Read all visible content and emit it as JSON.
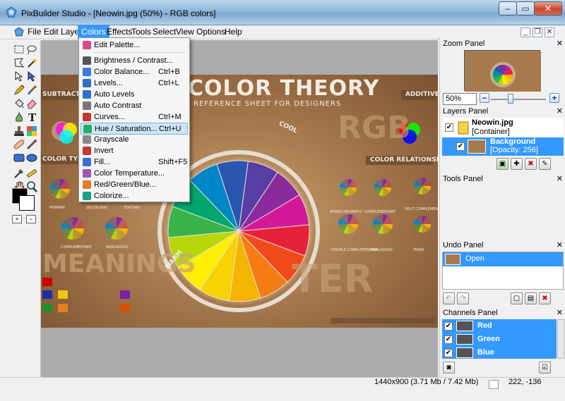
{
  "window": {
    "title": "PixBuilder Studio - [Neowin.jpg (50%) - RGB colors]",
    "min_label": "‒",
    "max_label": "▭",
    "close_label": "✕"
  },
  "menu": [
    {
      "label": "File"
    },
    {
      "label": "Edit"
    },
    {
      "label": "Layer"
    },
    {
      "label": "Colors"
    },
    {
      "label": "Effects"
    },
    {
      "label": "Tools"
    },
    {
      "label": "Select"
    },
    {
      "label": "View"
    },
    {
      "label": "Options"
    },
    {
      "label": "Help"
    }
  ],
  "colors_menu": {
    "items": [
      {
        "label": "Edit Palette...",
        "shortcut": "",
        "icon_color": "#d9488a"
      },
      {
        "label": "Brightness / Contrast...",
        "shortcut": "",
        "icon_color": "#555555"
      },
      {
        "label": "Color Balance...",
        "shortcut": "Ctrl+B",
        "icon_color": "#3a7bd5"
      },
      {
        "label": "Levels...",
        "shortcut": "Ctrl+L",
        "icon_color": "#2e6fc7"
      },
      {
        "label": "Auto Levels",
        "shortcut": "",
        "icon_color": "#2e6fc7"
      },
      {
        "label": "Auto Contrast",
        "shortcut": "",
        "icon_color": "#777777"
      },
      {
        "label": "Curves...",
        "shortcut": "Ctrl+M",
        "icon_color": "#c0392b"
      },
      {
        "label": "Hue / Saturation...",
        "shortcut": "Ctrl+U",
        "icon_color": "#27ae60"
      },
      {
        "label": "Grayscale",
        "shortcut": "",
        "icon_color": "#888888"
      },
      {
        "label": "Invert",
        "shortcut": "",
        "icon_color": "#cc3333"
      },
      {
        "label": "Fill...",
        "shortcut": "Shift+F5",
        "icon_color": "#3a6fd5"
      },
      {
        "label": "Color Temperature...",
        "shortcut": "",
        "icon_color": "#9b59b6"
      },
      {
        "label": "Red/Green/Blue...",
        "shortcut": "",
        "icon_color": "#e67e22"
      },
      {
        "label": "Colorize...",
        "shortcut": "",
        "icon_color": "#16a085"
      }
    ],
    "highlighted": "Hue / Saturation..."
  },
  "poster": {
    "title": "COLOR THEORY",
    "subtitle": "REFERENCE SHEET FOR DESIGNERS",
    "subtractive": "SUBTRACTIVE",
    "additive": "ADDITIVE",
    "rgb": "RGB",
    "color_types": "COLOR TYPES",
    "color_relationships": "COLOR RELATIONSHIPS",
    "meanings": "MEANINGS",
    "cool": "COOL",
    "warm": "WARM",
    "terms": "TER",
    "primary": "PRIMARY",
    "secondary": "SECONDARY",
    "tertiary": "TERTIARY",
    "complementary": "COMPLEMENTARY",
    "analogous": "ANALOGOUS",
    "monochromatic": "MONOCHROMATIC",
    "complementary2": "COMPLEMENTARY",
    "split_complementary": "SPLIT COMPLEMENTARY",
    "double_complementary": "DOUBLE COMPLEMENTARY",
    "analogous2": "ANALOGOUS",
    "triad": "TRIAD"
  },
  "zoom_panel": {
    "title": "Zoom Panel",
    "value": "50%",
    "minus": "−",
    "plus": "+"
  },
  "layers_panel": {
    "title": "Layers Panel",
    "layers": [
      {
        "name": "Neowin.jpg",
        "detail": "[Container]",
        "checked": true
      },
      {
        "name": "Background",
        "detail": "[Opacity: 256]",
        "checked": true
      }
    ]
  },
  "tools_panel": {
    "title": "Tools Panel"
  },
  "undo_panel": {
    "title": "Undo Panel",
    "items": [
      {
        "label": "Open"
      }
    ]
  },
  "channels_panel": {
    "title": "Channels Panel",
    "channels": [
      {
        "label": "Red"
      },
      {
        "label": "Green"
      },
      {
        "label": "Blue"
      }
    ]
  },
  "status": {
    "dimensions": "1440x900  (3.71 Mb / 7.42 Mb)",
    "coordinates": "222, -136"
  },
  "close_x": "✕"
}
